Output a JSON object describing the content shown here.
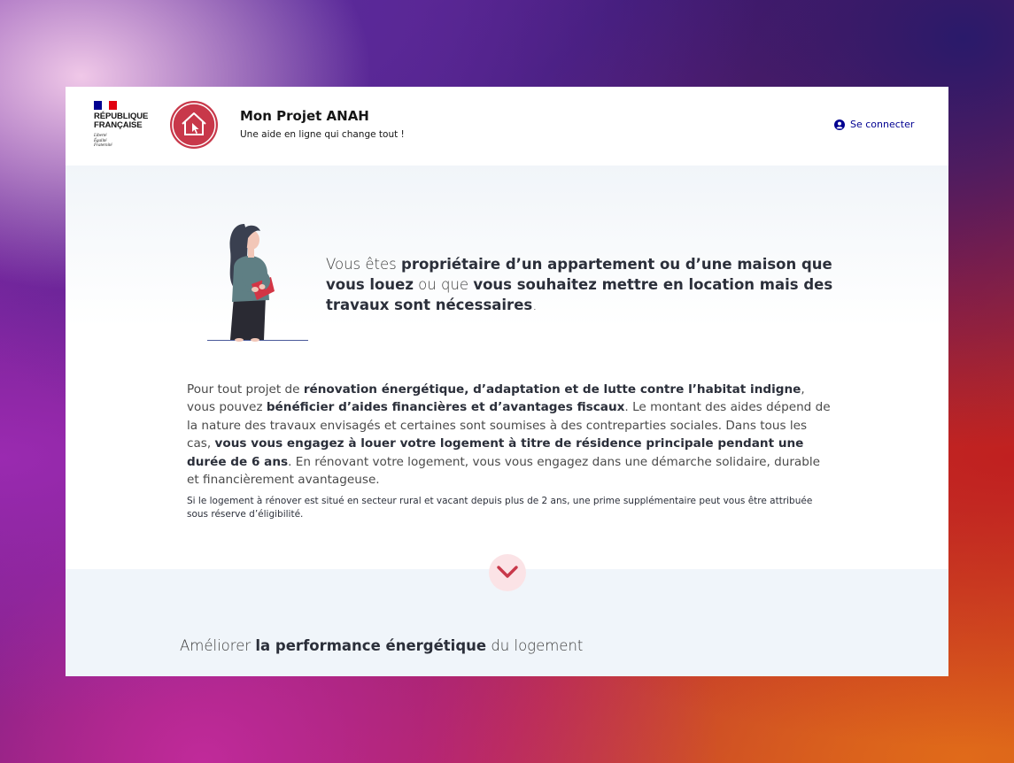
{
  "header": {
    "gov_logo": {
      "name": "RÉPUBLIQUE\nFRANÇAISE",
      "motto": "Liberté\nÉgalité\nFraternité",
      "flag_colors": [
        "#000091",
        "#ffffff",
        "#e1000f"
      ]
    },
    "brand": {
      "logo_icon": "house-cursor-icon",
      "title": "Mon Projet ANAH",
      "subtitle": "Une aide en ligne qui change tout !"
    },
    "login": {
      "icon": "user-circle-icon",
      "label": "Se connecter"
    }
  },
  "intro": {
    "illustration": "woman-holding-folder-illustration",
    "lead": {
      "p1": "Vous êtes ",
      "b1": "propriétaire d’un appartement ou d’une maison que vous louez",
      "p2": " ou que ",
      "b2": "vous souhaitez mettre en location mais des travaux sont nécessaires",
      "p3": "."
    },
    "body": {
      "p1": "Pour tout projet de ",
      "b1": "rénovation énergétique, d’adaptation et de lutte contre l’habitat indigne",
      "p2": ", vous pouvez ",
      "b2": "bénéficier d’aides financières et d’avantages fiscaux",
      "p3": ". Le montant des aides dépend de la nature des travaux envisagés et certaines sont soumises à des contreparties sociales. Dans tous les cas, ",
      "b3": "vous vous engagez à louer votre logement à titre de résidence principale pendant une durée de 6 ans",
      "p4": ". En rénovant votre logement, vous vous engagez dans une démarche solidaire, durable et financièrement avantageuse."
    },
    "note": "Si le logement à rénover est situé en secteur rural et vacant depuis plus de 2 ans, une prime supplémentaire peut vous être attribuée sous réserve d’éligibilité."
  },
  "scroll_button": {
    "icon": "chevron-down-icon"
  },
  "section2": {
    "p1": "Améliorer ",
    "b1": "la performance énergétique",
    "p2": " du logement"
  },
  "colors": {
    "accent": "#c8384a",
    "link": "#000091",
    "text": "#2b2f3a"
  }
}
